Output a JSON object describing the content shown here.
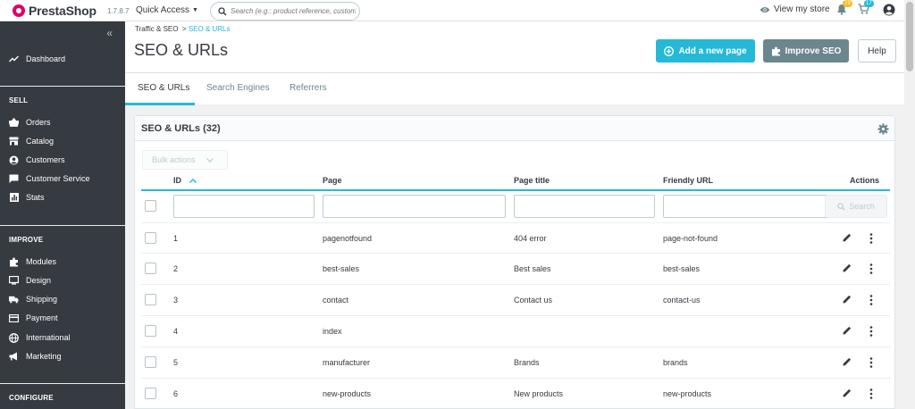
{
  "header": {
    "brand": "PrestaShop",
    "version": "1.7.8.7",
    "quick_access": "Quick Access",
    "search_placeholder": "Search (e.g.: product reference, custom",
    "view_store": "View my store",
    "notif_count_1": "79",
    "notif_count_2": "17"
  },
  "sidebar": {
    "collapse_icon": "«",
    "dashboard": "Dashboard",
    "sell_title": "SELL",
    "sell_items": [
      "Orders",
      "Catalog",
      "Customers",
      "Customer Service",
      "Stats"
    ],
    "improve_title": "IMPROVE",
    "improve_items": [
      "Modules",
      "Design",
      "Shipping",
      "Payment",
      "International",
      "Marketing"
    ],
    "configure_title": "CONFIGURE"
  },
  "page": {
    "breadcrumb_parent": "Traffic & SEO",
    "breadcrumb_sep": ">",
    "breadcrumb_current": "SEO & URLs",
    "title": "SEO & URLs",
    "add_button": "Add a new page",
    "improve_button": "Improve SEO",
    "help_button": "Help"
  },
  "tabs": [
    "SEO & URLs",
    "Search Engines",
    "Referrers"
  ],
  "card": {
    "title": "SEO & URLs (32)",
    "bulk_actions": "Bulk actions",
    "columns": {
      "id": "ID",
      "page": "Page",
      "page_title": "Page title",
      "friendly_url": "Friendly URL",
      "actions": "Actions"
    },
    "search_button": "Search",
    "rows": [
      {
        "id": "1",
        "page": "pagenotfound",
        "title": "404 error",
        "url": "page-not-found"
      },
      {
        "id": "2",
        "page": "best-sales",
        "title": "Best sales",
        "url": "best-sales"
      },
      {
        "id": "3",
        "page": "contact",
        "title": "Contact us",
        "url": "contact-us"
      },
      {
        "id": "4",
        "page": "index",
        "title": "",
        "url": ""
      },
      {
        "id": "5",
        "page": "manufacturer",
        "title": "Brands",
        "url": "brands"
      },
      {
        "id": "6",
        "page": "new-products",
        "title": "New products",
        "url": "new-products"
      }
    ]
  },
  "colors": {
    "accent": "#25b9d7",
    "sidebar": "#363a41",
    "secondary": "#6c868e"
  }
}
